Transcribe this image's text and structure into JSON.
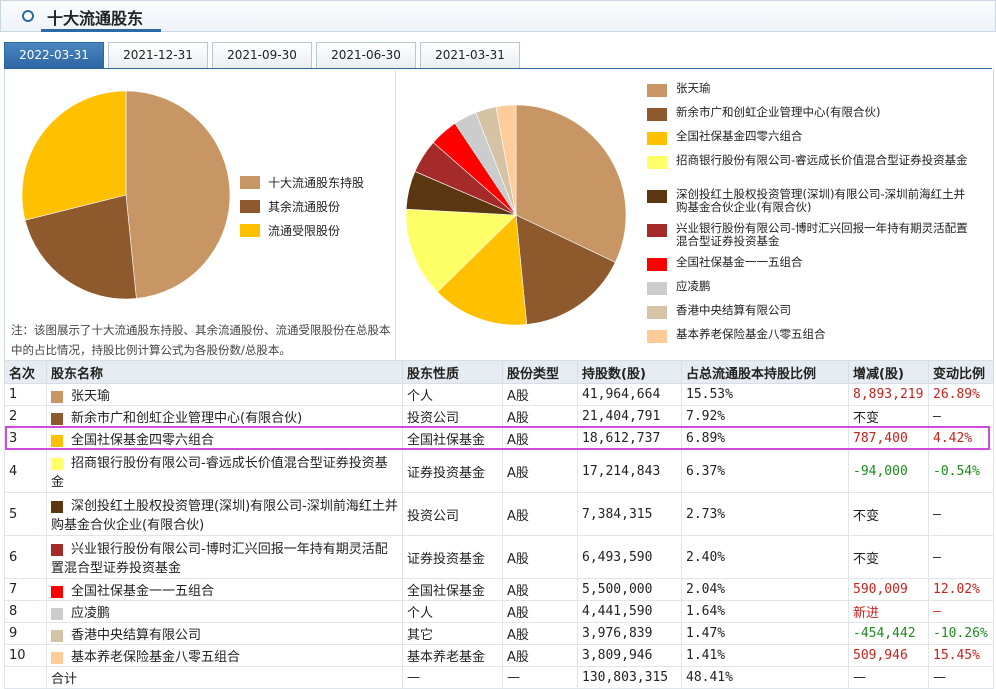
{
  "header": {
    "title": "十大流通股东"
  },
  "tabs": [
    "2022-03-31",
    "2021-12-31",
    "2021-09-30",
    "2021-06-30",
    "2021-03-31"
  ],
  "active_tab": 0,
  "pie1": {
    "legend": [
      "十大流通股东持股",
      "其余流通股份",
      "流通受限股份"
    ],
    "colors": [
      "#c89564",
      "#8e5a2d",
      "#ffc000"
    ],
    "percent": [
      48.41,
      22.7,
      28.89
    ]
  },
  "pie2": {
    "legend": [
      "张天瑜",
      "新余市广和创虹企业管理中心(有限合伙)",
      "全国社保基金四零六组合",
      "招商银行股份有限公司-睿远成长价值混合型证券投资基金",
      "深创投红土股权投资管理(深圳)有限公司-深圳前海红土并购基金合伙企业(有限合伙)",
      "兴业银行股份有限公司-博时汇兴回报一年持有期灵活配置混合型证券投资基金",
      "全国社保基金一一五组合",
      "应凌鹏",
      "香港中央结算有限公司",
      "基本养老保险基金八零五组合"
    ],
    "colors": [
      "#c89564",
      "#8e5a2d",
      "#ffc000",
      "#ffff66",
      "#5a3710",
      "#a52a2a",
      "#ff0000",
      "#cccccc",
      "#d6c3a5",
      "#ffcc99"
    ],
    "values": [
      41964664,
      21404791,
      18612737,
      17214843,
      7384315,
      6493590,
      5500000,
      4441590,
      3976839,
      3809946
    ]
  },
  "note": "注：该图展示了十大流通股东持股、其余流通股份、流通受限股份在总股本中的占比情况，持股比例计算公式为各股份数/总股本。",
  "table": {
    "headers": [
      "名次",
      "股东名称",
      "股东性质",
      "股份类型",
      "持股数(股)",
      "占总流通股本持股比例",
      "增减(股)",
      "变动比例"
    ],
    "rows": [
      {
        "rank": "1",
        "name": "张天瑜",
        "nature": "个人",
        "type": "A股",
        "shares": "41,964,664",
        "ratio": "15.53%",
        "change": "8,893,219",
        "change_ratio": "26.89%",
        "change_class": "red"
      },
      {
        "rank": "2",
        "name": "新余市广和创虹企业管理中心(有限合伙)",
        "nature": "投资公司",
        "type": "A股",
        "shares": "21,404,791",
        "ratio": "7.92%",
        "change": "不变",
        "change_ratio": "—",
        "change_class": ""
      },
      {
        "rank": "3",
        "name": "全国社保基金四零六组合",
        "nature": "全国社保基金",
        "type": "A股",
        "shares": "18,612,737",
        "ratio": "6.89%",
        "change": "787,400",
        "change_ratio": "4.42%",
        "change_class": "red"
      },
      {
        "rank": "4",
        "name": "招商银行股份有限公司-睿远成长价值混合型证券投资基金",
        "nature": "证券投资基金",
        "type": "A股",
        "shares": "17,214,843",
        "ratio": "6.37%",
        "change": "-94,000",
        "change_ratio": "-0.54%",
        "change_class": "green"
      },
      {
        "rank": "5",
        "name": "深创投红土股权投资管理(深圳)有限公司-深圳前海红土并购基金合伙企业(有限合伙)",
        "nature": "投资公司",
        "type": "A股",
        "shares": "7,384,315",
        "ratio": "2.73%",
        "change": "不变",
        "change_ratio": "—",
        "change_class": ""
      },
      {
        "rank": "6",
        "name": "兴业银行股份有限公司-博时汇兴回报一年持有期灵活配置混合型证券投资基金",
        "nature": "证券投资基金",
        "type": "A股",
        "shares": "6,493,590",
        "ratio": "2.40%",
        "change": "不变",
        "change_ratio": "—",
        "change_class": ""
      },
      {
        "rank": "7",
        "name": "全国社保基金一一五组合",
        "nature": "全国社保基金",
        "type": "A股",
        "shares": "5,500,000",
        "ratio": "2.04%",
        "change": "590,009",
        "change_ratio": "12.02%",
        "change_class": "red"
      },
      {
        "rank": "8",
        "name": "应凌鹏",
        "nature": "个人",
        "type": "A股",
        "shares": "4,441,590",
        "ratio": "1.64%",
        "change": "新进",
        "change_ratio": "—",
        "change_class": "red"
      },
      {
        "rank": "9",
        "name": "香港中央结算有限公司",
        "nature": "其它",
        "type": "A股",
        "shares": "3,976,839",
        "ratio": "1.47%",
        "change": "-454,442",
        "change_ratio": "-10.26%",
        "change_class": "green"
      },
      {
        "rank": "10",
        "name": "基本养老保险基金八零五组合",
        "nature": "基本养老基金",
        "type": "A股",
        "shares": "3,809,946",
        "ratio": "1.41%",
        "change": "509,946",
        "change_ratio": "15.45%",
        "change_class": "red"
      }
    ],
    "total": {
      "label": "合计",
      "nature": "—",
      "type": "—",
      "shares": "130,803,315",
      "ratio": "48.41%",
      "change": "—",
      "change_ratio": "—"
    }
  },
  "highlighted_row": 3
}
